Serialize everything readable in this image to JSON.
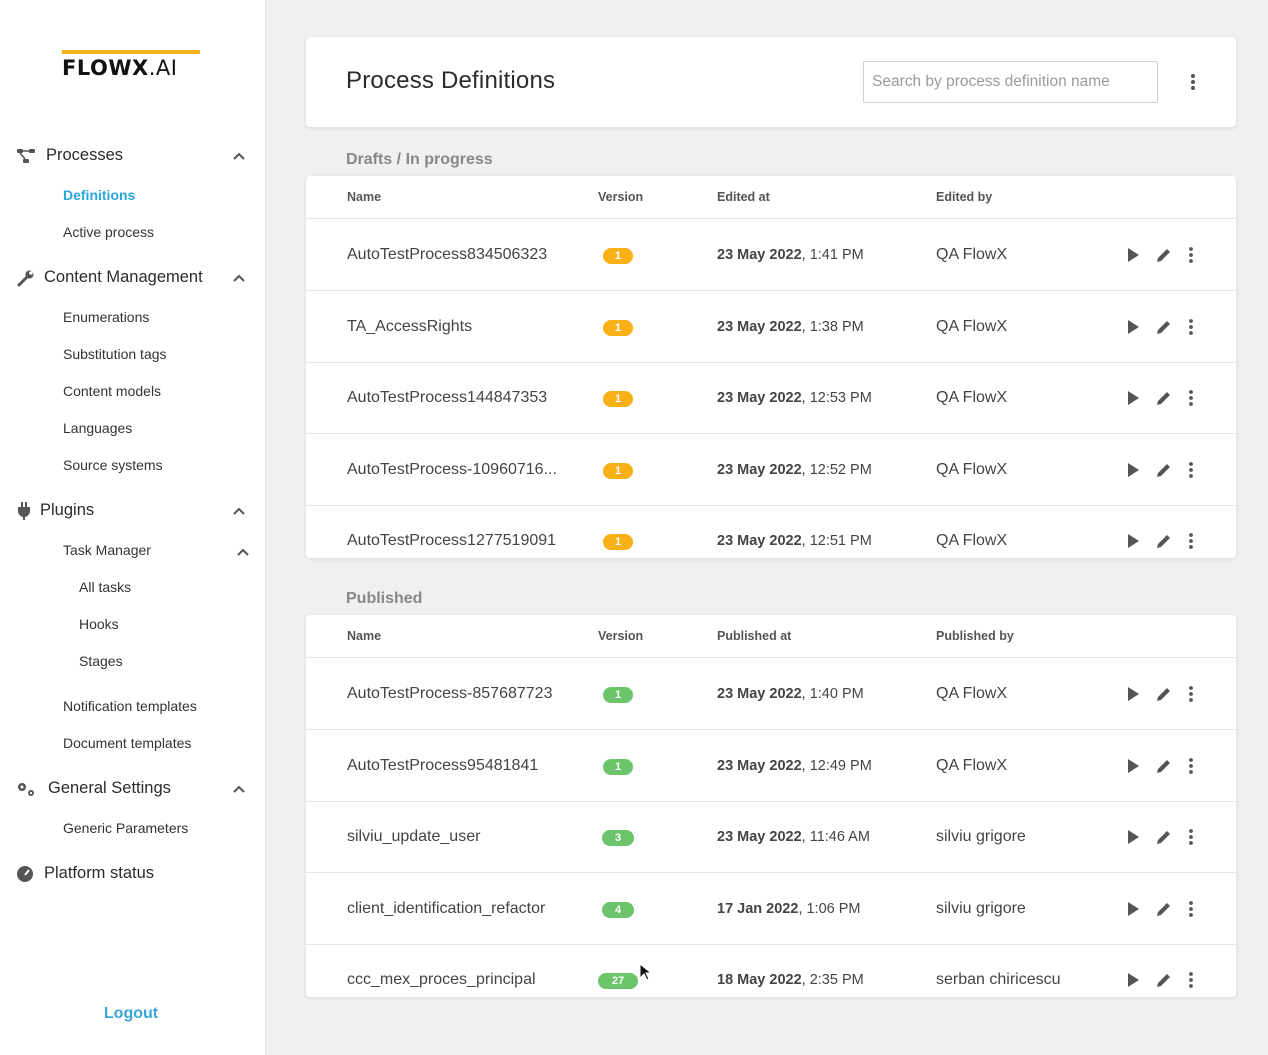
{
  "sidebar": {
    "logo": {
      "brand": "FLOWX",
      "suffix": ".AI"
    },
    "sections": [
      {
        "label": "Processes",
        "icon": "flow-icon",
        "items": [
          "Definitions",
          "Active process"
        ]
      },
      {
        "label": "Content Management",
        "icon": "wrench-icon",
        "items": [
          "Enumerations",
          "Substitution tags",
          "Content models",
          "Languages",
          "Source systems"
        ]
      },
      {
        "label": "Plugins",
        "icon": "plug-icon",
        "items": [
          "Task Manager",
          "All tasks",
          "Hooks",
          "Stages",
          "Notification templates",
          "Document templates"
        ]
      },
      {
        "label": "General Settings",
        "icon": "gears-icon",
        "items": [
          "Generic Parameters"
        ]
      },
      {
        "label": "Platform status",
        "icon": "gauge-icon",
        "items": []
      }
    ],
    "active_item": "Definitions",
    "logout": "Logout"
  },
  "header": {
    "title": "Process Definitions",
    "search_placeholder": "Search by process definition name"
  },
  "drafts": {
    "title": "Drafts / In progress",
    "columns": [
      "Name",
      "Version",
      "Edited at",
      "Edited by"
    ],
    "rows": [
      {
        "name": "AutoTestProcess834506323",
        "version": "1",
        "date": "23 May 2022",
        "time": ", 1:41 PM",
        "user": "QA FlowX"
      },
      {
        "name": "TA_AccessRights",
        "version": "1",
        "date": "23 May 2022",
        "time": ", 1:38 PM",
        "user": "QA FlowX"
      },
      {
        "name": "AutoTestProcess144847353",
        "version": "1",
        "date": "23 May 2022",
        "time": ", 12:53 PM",
        "user": "QA FlowX"
      },
      {
        "name": "AutoTestProcess-10960716...",
        "version": "1",
        "date": "23 May 2022",
        "time": ", 12:52 PM",
        "user": "QA FlowX"
      },
      {
        "name": "AutoTestProcess1277519091",
        "version": "1",
        "date": "23 May 2022",
        "time": ", 12:51 PM",
        "user": "QA FlowX"
      }
    ]
  },
  "published": {
    "title": "Published",
    "columns": [
      "Name",
      "Version",
      "Published at",
      "Published by"
    ],
    "rows": [
      {
        "name": "AutoTestProcess-857687723",
        "version": "1",
        "date": "23 May 2022",
        "time": ", 1:40 PM",
        "user": "QA FlowX"
      },
      {
        "name": "AutoTestProcess95481841",
        "version": "1",
        "date": "23 May 2022",
        "time": ", 12:49 PM",
        "user": "QA FlowX"
      },
      {
        "name": "silviu_update_user",
        "version": "3",
        "date": "23 May 2022",
        "time": ", 11:46 AM",
        "user": "silviu grigore"
      },
      {
        "name": "client_identification_refactor",
        "version": "4",
        "date": "17 Jan 2022",
        "time": ", 1:06 PM",
        "user": "silviu grigore"
      },
      {
        "name": "ccc_mex_proces_principal",
        "version": "27",
        "date": "18 May 2022",
        "time": ", 2:35 PM",
        "user": "serban chiricescu"
      }
    ]
  },
  "colors": {
    "accent": "#2aa7dd",
    "draft_badge": "#f7b016",
    "published_badge": "#6cc46b",
    "logo_bar": "#f5b31b"
  }
}
